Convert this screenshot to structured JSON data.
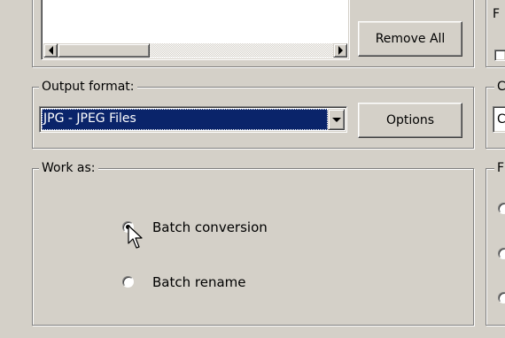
{
  "file_list": {
    "remove_all_label": "Remove All"
  },
  "output_format": {
    "legend": "Output format:",
    "selected": "JPG - JPEG Files",
    "options_label": "Options"
  },
  "work_as": {
    "legend": "Work as:",
    "options": [
      {
        "label": "Batch conversion",
        "checked": true
      },
      {
        "label": "Batch rename",
        "checked": false
      }
    ]
  },
  "right_clipped": {
    "top_letter": "F",
    "mid_letter": "C",
    "mid_field_value": "C",
    "bottom_letter": "F"
  },
  "colors": {
    "face": "#d4d0c8",
    "selection": "#0a246a",
    "selection_text": "#ffffff"
  }
}
